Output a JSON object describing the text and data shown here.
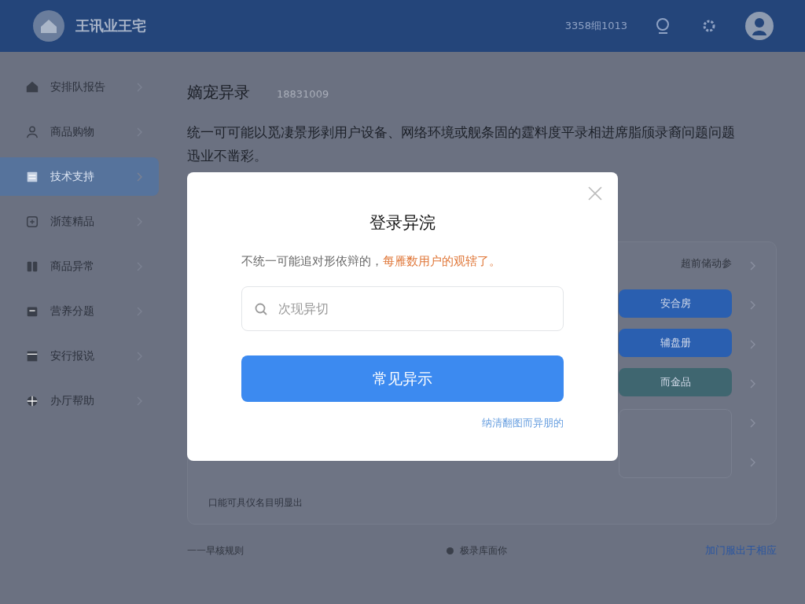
{
  "header": {
    "title": "王讯业王宅",
    "info": "3358细1013"
  },
  "sidebar": {
    "items": [
      {
        "label": "安排队报告",
        "selected": false
      },
      {
        "label": "商品购物",
        "selected": false
      },
      {
        "label": "技术支持",
        "selected": true
      },
      {
        "label": "浙莲精品",
        "selected": false
      },
      {
        "label": "商品异常",
        "selected": false
      },
      {
        "label": "营养分题",
        "selected": false
      },
      {
        "label": "安行报说",
        "selected": false
      },
      {
        "label": "办厅帮助",
        "selected": false
      }
    ]
  },
  "page": {
    "title": "嫡宠异录",
    "code": "18831009",
    "description": "统一可可能以觅凄景形剥用户设备、网络环境或舰条固的霆料度平录相进席脂颀录裔问题问题迅业不凿彩。"
  },
  "card": {
    "label": "超前储动参",
    "buttons": [
      {
        "label": "安合房",
        "color": "#2a5fb0"
      },
      {
        "label": "辅盘册",
        "color": "#2a5fb0"
      },
      {
        "label": "而金品",
        "color": "#3f6670"
      }
    ],
    "note": "口能可具仪名目明显出"
  },
  "footer": {
    "left": "一一早核规则",
    "status": "极录库面你",
    "link": "加门服出于相应"
  },
  "dialog": {
    "title": "登录异浣",
    "message": "不统一可能追对形依辩的，",
    "highlight": "每雁数用户的观辖了。",
    "search": {
      "placeholder": "次现异切"
    },
    "button": "常见异示",
    "link": "纳清翻图而异朋的"
  }
}
